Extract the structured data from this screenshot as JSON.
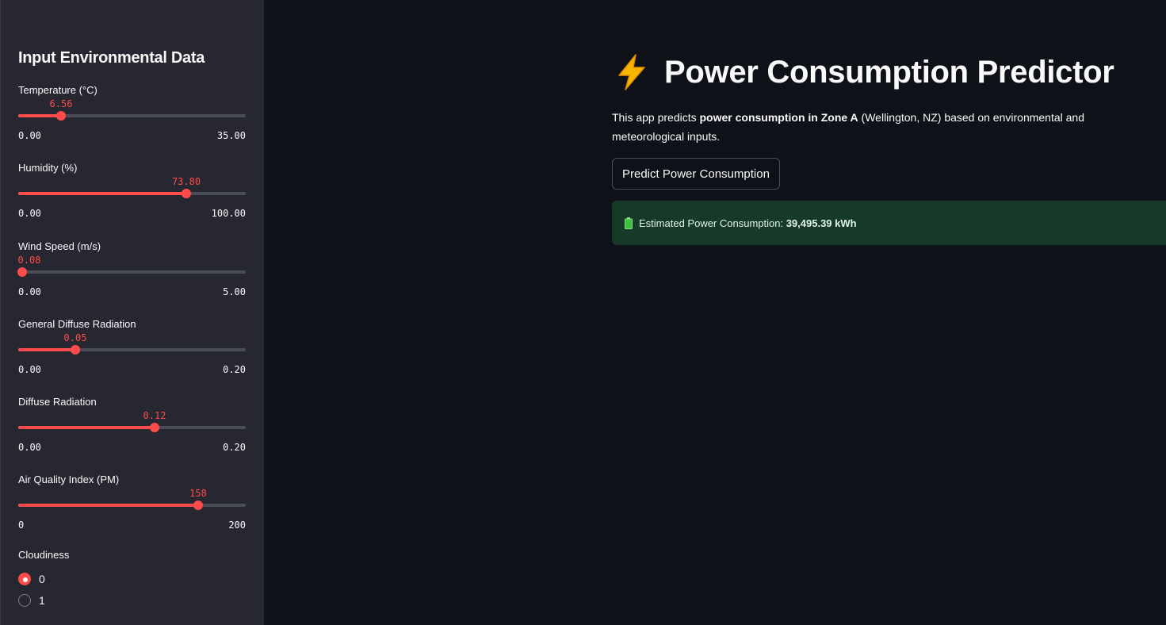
{
  "sidebar": {
    "title": "Input Environmental Data",
    "sliders": [
      {
        "label": "Temperature (°C)",
        "value": "6.56",
        "min": "0.00",
        "max": "35.00",
        "fraction": 0.1874
      },
      {
        "label": "Humidity (%)",
        "value": "73.80",
        "min": "0.00",
        "max": "100.00",
        "fraction": 0.738
      },
      {
        "label": "Wind Speed (m/s)",
        "value": "0.08",
        "min": "0.00",
        "max": "5.00",
        "fraction": 0.016
      },
      {
        "label": "General Diffuse Radiation",
        "value": "0.05",
        "min": "0.00",
        "max": "0.20",
        "fraction": 0.25
      },
      {
        "label": "Diffuse Radiation",
        "value": "0.12",
        "min": "0.00",
        "max": "0.20",
        "fraction": 0.6
      },
      {
        "label": "Air Quality Index (PM)",
        "value": "158",
        "min": "0",
        "max": "200",
        "fraction": 0.79
      }
    ],
    "cloudiness": {
      "label": "Cloudiness",
      "options": [
        "0",
        "1"
      ],
      "selected": "0"
    }
  },
  "main": {
    "title_icon": "lightning-bolt-icon",
    "title": "Power Consumption Predictor",
    "description": {
      "part1": "This app predicts ",
      "bold1": "power consumption in Zone A",
      "part2": " (Wellington, NZ) based on environmental and meteorological inputs."
    },
    "predict_button_label": "Predict Power Consumption",
    "result": {
      "icon": "battery-icon",
      "label": "Estimated Power Consumption: ",
      "value": "39,495.39 kWh"
    }
  },
  "colors": {
    "background": "#0e1117",
    "sidebar": "#262730",
    "accent": "#ff4b4b",
    "success_bg": "#173928"
  }
}
